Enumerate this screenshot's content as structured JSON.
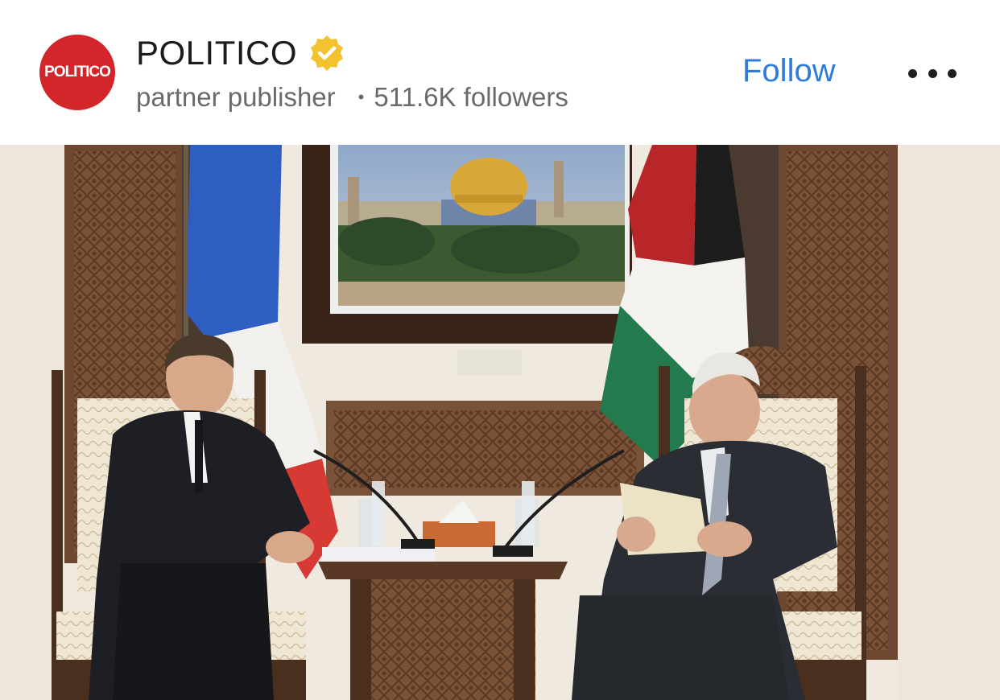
{
  "post_header": {
    "avatar_text": "POLITICO",
    "publisher_name": "POLITICO",
    "subtitle": "partner publisher",
    "followers": "511.6K followers",
    "follow_label": "Follow"
  },
  "colors": {
    "avatar_bg": "#d3262a",
    "follow_text": "#2f7bd9",
    "verified_badge": "#f2c230"
  },
  "icons": {
    "verified": "verified-badge-icon",
    "more": "more-options-icon"
  }
}
